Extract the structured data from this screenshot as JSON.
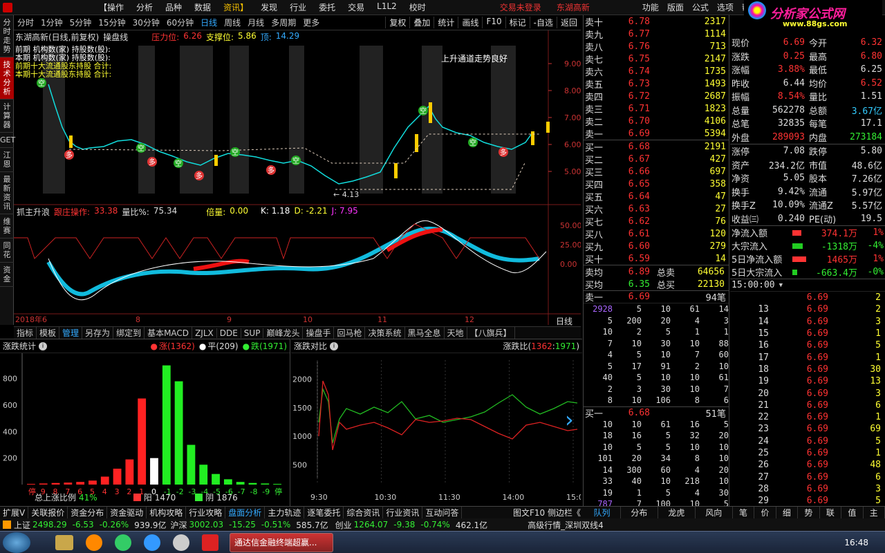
{
  "menubar": {
    "items": [
      "【操作",
      "分析",
      "品种",
      "数据",
      "资讯】",
      "发现",
      "行业",
      "委托",
      "交易",
      "L1L2",
      "校时"
    ],
    "active_index": 4,
    "login": "交易未登录",
    "stock": "东湖高新",
    "right": [
      "功能",
      "版面",
      "公式",
      "选项",
      "帮助"
    ],
    "logo": "分析家公式网",
    "logo_url": "www.88gs.com"
  },
  "lefttabs": [
    "分时走势",
    "技术分析",
    "计算器",
    "GET",
    "江恩",
    "最新资讯",
    "维赛",
    "同花",
    "资金"
  ],
  "periods": [
    "分时",
    "1分钟",
    "5分钟",
    "15分钟",
    "30分钟",
    "60分钟",
    "日线",
    "周线",
    "月线",
    "多周期",
    "更多"
  ],
  "period_active": "日线",
  "toolbar": [
    "复权",
    "叠加",
    "统计",
    "画线",
    "F10",
    "标记",
    "-自选",
    "返回"
  ],
  "kline": {
    "title": "东湖高新(日线,前复权)",
    "indicator": "操盘线",
    "pressure_label": "压力位:",
    "pressure": "6.26",
    "support_label": "支撑位:",
    "support": "5.86",
    "other_label": "顶:",
    "other": "14.29",
    "note": "上升通道走势良好",
    "low_label": "← 4.13",
    "legend1": "前期 机构数(家) 持股数(股):",
    "legend2": "本期 机构数(家) 持股数(股):",
    "legend3": "前期十大流通股东持股 合计:",
    "legend4": "本期十大流通股东持股 合计:",
    "axis": [
      "9.00",
      "8.00",
      "7.00",
      "6.00",
      "5.00"
    ]
  },
  "sub": {
    "name": "抓主升浪",
    "label1": "跟庄操作:",
    "v1": "33.38",
    "label2": "量比%:",
    "v2": "75.34",
    "label3": "倍量:",
    "v3": "0.00",
    "k": "K: 1.18",
    "d": "D: -2.21",
    "j": "J: 7.95",
    "axis": [
      "50.00",
      "25.00",
      "0.00"
    ],
    "dates": [
      "2018年6",
      "8",
      "9",
      "10",
      "11",
      "12"
    ],
    "period": "日线"
  },
  "bottabs": [
    "指标",
    "模板",
    "管理",
    "另存为",
    "绑定到",
    "基本MACD",
    "ZJLX",
    "DDE",
    "SUP",
    "巅峰龙头",
    "操盘手",
    "回马枪",
    "决策系统",
    "黑马全息",
    "天地",
    "【八旗兵】"
  ],
  "bottab_active": "管理",
  "zdtj": {
    "title": "涨跌统计",
    "up": "涨(1362)",
    "flat": "平(209)",
    "down": "跌(1971)",
    "ratio_label": "总上涨比例",
    "ratio": "41%",
    "yang_label": "阳",
    "yang": "1470",
    "yin_label": "阴",
    "yin": "1876"
  },
  "zdbar": {
    "categories": [
      "停",
      "9",
      "8",
      "7",
      "6",
      "5",
      "4",
      "3",
      "2",
      "1",
      "0",
      "-1",
      "-2",
      "-3",
      "-4",
      "-5",
      "-6",
      "-7",
      "-8",
      "-9",
      "停"
    ],
    "values": [
      5,
      8,
      12,
      15,
      20,
      30,
      60,
      120,
      190,
      650,
      200,
      900,
      780,
      300,
      150,
      80,
      40,
      20,
      12,
      8,
      5
    ],
    "ylim": [
      0,
      950
    ],
    "yticks": [
      200,
      400,
      600,
      800
    ]
  },
  "zddb": {
    "title": "涨跌对比",
    "ratio_label": "涨跌比(",
    "up": "1362",
    "down": "1971",
    "close": ")"
  },
  "zdline": {
    "times": [
      "9:30",
      "10:30",
      "11:30",
      "14:00",
      "15:00"
    ],
    "yticks": [
      500,
      1000,
      1500,
      2000
    ]
  },
  "asks": [
    {
      "l": "卖十",
      "p": "6.78",
      "v": "2317"
    },
    {
      "l": "卖九",
      "p": "6.77",
      "v": "1114"
    },
    {
      "l": "卖八",
      "p": "6.76",
      "v": "713"
    },
    {
      "l": "卖七",
      "p": "6.75",
      "v": "2147"
    },
    {
      "l": "卖六",
      "p": "6.74",
      "v": "1735"
    },
    {
      "l": "卖五",
      "p": "6.73",
      "v": "1493"
    },
    {
      "l": "卖四",
      "p": "6.72",
      "v": "2687"
    },
    {
      "l": "卖三",
      "p": "6.71",
      "v": "1823"
    },
    {
      "l": "卖二",
      "p": "6.70",
      "v": "4106"
    },
    {
      "l": "卖一",
      "p": "6.69",
      "v": "5394"
    }
  ],
  "bids": [
    {
      "l": "买一",
      "p": "6.68",
      "v": "2191"
    },
    {
      "l": "买二",
      "p": "6.67",
      "v": "427"
    },
    {
      "l": "买三",
      "p": "6.66",
      "v": "697"
    },
    {
      "l": "买四",
      "p": "6.65",
      "v": "358"
    },
    {
      "l": "买五",
      "p": "6.64",
      "v": "47"
    },
    {
      "l": "买六",
      "p": "6.63",
      "v": "27"
    },
    {
      "l": "买七",
      "p": "6.62",
      "v": "76"
    },
    {
      "l": "买八",
      "p": "6.61",
      "v": "120"
    },
    {
      "l": "买九",
      "p": "6.60",
      "v": "279"
    },
    {
      "l": "买十",
      "p": "6.59",
      "v": "14"
    }
  ],
  "avg": {
    "sell_l": "卖均",
    "sell_p": "6.89",
    "sell_t": "总卖",
    "sell_v": "64656",
    "buy_l": "买均",
    "buy_p": "6.35",
    "buy_t": "总买",
    "buy_v": "22130"
  },
  "queue_sell": {
    "label": "卖一",
    "price": "6.69",
    "count": "94笔",
    "rows": [
      [
        "2928",
        "5",
        "10",
        "61",
        "14"
      ],
      [
        "5",
        "200",
        "20",
        "4",
        "3"
      ],
      [
        "10",
        "2",
        "5",
        "1",
        "1"
      ],
      [
        "7",
        "10",
        "30",
        "10",
        "88"
      ],
      [
        "4",
        "5",
        "10",
        "7",
        "60"
      ],
      [
        "5",
        "17",
        "91",
        "2",
        "10"
      ],
      [
        "40",
        "5",
        "10",
        "10",
        "61"
      ],
      [
        "2",
        "3",
        "30",
        "10",
        "7"
      ],
      [
        "8",
        "10",
        "106",
        "8",
        "6"
      ]
    ]
  },
  "queue_buy": {
    "label": "买一",
    "price": "6.68",
    "count": "51笔",
    "rows": [
      [
        "10",
        "10",
        "61",
        "16",
        "5"
      ],
      [
        "18",
        "16",
        "5",
        "32",
        "20"
      ],
      [
        "10",
        "5",
        "5",
        "10",
        "10"
      ],
      [
        "101",
        "20",
        "34",
        "8",
        "10"
      ],
      [
        "14",
        "300",
        "60",
        "4",
        "20"
      ],
      [
        "33",
        "40",
        "10",
        "218",
        "10"
      ],
      [
        "19",
        "1",
        "5",
        "4",
        "30"
      ],
      [
        "787",
        "7",
        "100",
        "10",
        "5"
      ],
      [
        "1",
        "20",
        "1",
        "10",
        "23"
      ]
    ]
  },
  "info": [
    [
      "现价",
      "6.69",
      "今开",
      "6.32"
    ],
    [
      "涨跌",
      "0.25",
      "最高",
      "6.80"
    ],
    [
      "涨幅",
      "3.88%",
      "最低",
      "6.25"
    ],
    [
      "昨收",
      "6.44",
      "均价",
      "6.52"
    ],
    [
      "振幅",
      "8.54%",
      "量比",
      "1.51"
    ],
    [
      "总量",
      "562278",
      "总额",
      "3.67亿"
    ],
    [
      "总笔",
      "32835",
      "每笔",
      "17.1"
    ],
    [
      "外盘",
      "289093",
      "内盘",
      "273184"
    ]
  ],
  "info2": [
    [
      "涨停",
      "7.08",
      "跌停",
      "5.80"
    ],
    [
      "资产",
      "234.2亿",
      "市值",
      "48.6亿"
    ],
    [
      "净资",
      "5.05",
      "股本",
      "7.26亿"
    ],
    [
      "换手",
      "9.42%",
      "流通",
      "5.97亿"
    ],
    [
      "换手Z",
      "10.09%",
      "流通Z",
      "5.57亿"
    ],
    [
      "收益㈢",
      "0.240",
      "PE(动)",
      "19.5"
    ]
  ],
  "flows": [
    {
      "l": "净流入额",
      "v": "374.1万",
      "p": "1%",
      "c": "red",
      "bar": 0.6
    },
    {
      "l": "大宗流入",
      "v": "-1318万",
      "p": "-4%",
      "c": "green",
      "bar": 0.7
    },
    {
      "l": "5日净流入额",
      "v": "1465万",
      "p": "1%",
      "c": "red",
      "bar": 0.9
    },
    {
      "l": "5日大宗流入",
      "v": "-663.4万",
      "p": "-0%",
      "c": "green",
      "bar": 0.3
    }
  ],
  "ticks": {
    "time": "15:00:00",
    "rows": [
      [
        "",
        "6.69",
        "2"
      ],
      [
        "13",
        "6.69",
        "2"
      ],
      [
        "14",
        "6.69",
        "3"
      ],
      [
        "15",
        "6.69",
        "1"
      ],
      [
        "16",
        "6.69",
        "5"
      ],
      [
        "17",
        "6.69",
        "1"
      ],
      [
        "18",
        "6.69",
        "30"
      ],
      [
        "19",
        "6.69",
        "13"
      ],
      [
        "20",
        "6.69",
        "3"
      ],
      [
        "21",
        "6.69",
        "6"
      ],
      [
        "22",
        "6.69",
        "1"
      ],
      [
        "23",
        "6.69",
        "69"
      ],
      [
        "24",
        "6.69",
        "5"
      ],
      [
        "25",
        "6.69",
        "1"
      ],
      [
        "26",
        "6.69",
        "48"
      ],
      [
        "27",
        "6.69",
        "6"
      ],
      [
        "28",
        "6.69",
        "3"
      ],
      [
        "29",
        "6.69",
        "5"
      ],
      [
        "30",
        "6.69",
        "6"
      ]
    ]
  },
  "footer": [
    "扩展V",
    "关联报价",
    "资金分布",
    "资金驱动",
    "机构攻略",
    "行业攻略",
    "盘面分析",
    "主力轨迹",
    "逐笔委托",
    "综合资讯",
    "行业资讯",
    "互动问答"
  ],
  "footer_active": "盘面分析",
  "footer_right": "图文F10 侧边栏《",
  "footer_tabs": [
    "队列",
    "分布",
    "龙虎",
    "风向",
    "笔",
    "价",
    "细",
    "势",
    "联",
    "值",
    "主"
  ],
  "status": {
    "sh_l": "上证",
    "sh": "2498.29",
    "sh_c": "-6.53",
    "sh_p": "-0.26%",
    "sh_v": "939.9亿",
    "hs_l": "沪深",
    "hs": "3002.03",
    "hs_c": "-15.25",
    "hs_p": "-0.51%",
    "hs_v": "585.7亿",
    "cy_l": "创业",
    "cy": "1264.07",
    "cy_c": "-9.38",
    "cy_p": "-0.74%",
    "cy_v": "462.1亿",
    "msg": "高级行情_深圳双线4"
  },
  "taskbar": {
    "start": "开始",
    "window": "通达信金融终端超赢...",
    "time": "16:48"
  }
}
